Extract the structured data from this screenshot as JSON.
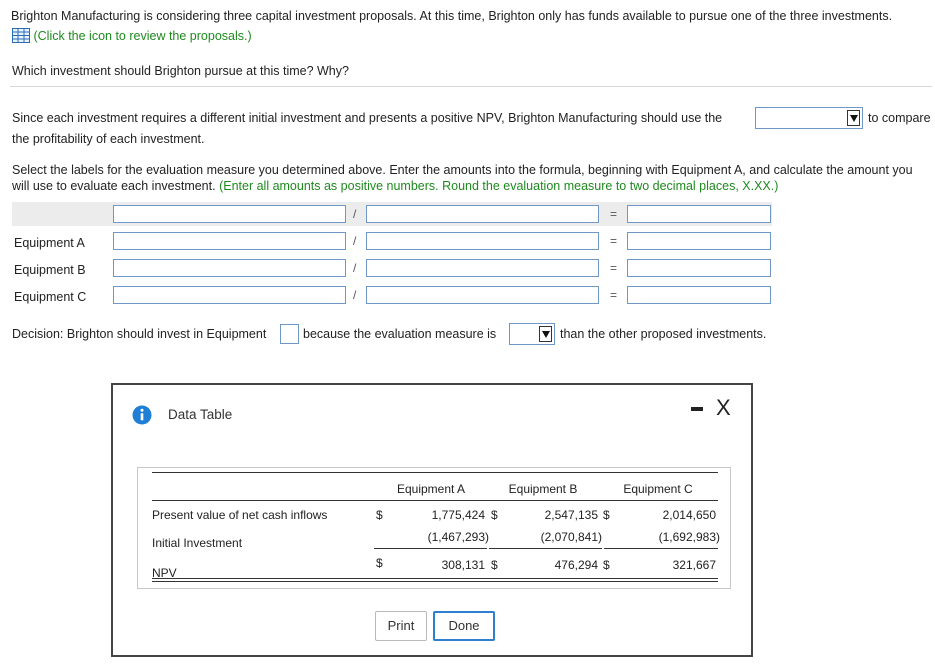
{
  "question": {
    "intro": "Brighton Manufacturing is considering three capital investment proposals. At this time, Brighton only has funds available to pursue one of the three investments.",
    "link_text": "(Click the icon to review the proposals.)",
    "ask": "Which investment should Brighton pursue at this time? Why?"
  },
  "body": {
    "para1_before": "Since each investment requires a different initial investment and presents a positive NPV, Brighton Manufacturing should use the",
    "para1_after": "to compare",
    "para1_line2": "the profitability of each investment.",
    "para2_main": "Select the labels for the evaluation measure you determined above. Enter the amounts into the formula, beginning with Equipment A, and calculate the amount you will use to evaluate each investment.",
    "para2_note": "(Enter all amounts as positive numbers. Round the evaluation measure to two decimal places, X.XX.)"
  },
  "formula": {
    "divide": "/",
    "equals": "=",
    "rows": [
      "Equipment A",
      "Equipment B",
      "Equipment C"
    ]
  },
  "decision": {
    "text1": "Decision: Brighton should invest in Equipment",
    "text2": "because the evaluation measure is",
    "text3": "than the other proposed investments."
  },
  "modal": {
    "title": "Data Table",
    "minimize": "-",
    "close": "X",
    "table": {
      "headers": [
        "Equipment A",
        "Equipment B",
        "Equipment C"
      ],
      "rows": [
        {
          "label": "Present value of net cash inflows",
          "cur": "$",
          "values": [
            "1,775,424",
            "2,547,135",
            "2,014,650"
          ]
        },
        {
          "label": "Initial Investment",
          "cur": "",
          "values": [
            "(1,467,293)",
            "(2,070,841)",
            "(1,692,983)"
          ]
        },
        {
          "label": "NPV",
          "cur": "$",
          "values": [
            "308,131",
            "476,294",
            "321,667"
          ]
        }
      ]
    },
    "print_label": "Print",
    "done_label": "Done"
  }
}
